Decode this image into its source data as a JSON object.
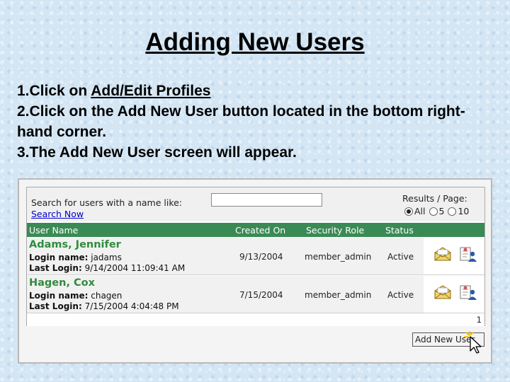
{
  "slide": {
    "title": "Adding New Users",
    "step1_prefix": "1.Click on ",
    "step1_link": "Add/Edit Profiles",
    "step2": "2.Click on the Add New User button located in the bottom right-hand corner.",
    "step3": "3.The Add New User screen will appear."
  },
  "search": {
    "label": "Search for users with a name like:",
    "value": "",
    "button": "Search Now"
  },
  "results_per_page": {
    "label": "Results / Page:",
    "options": [
      "All",
      "5",
      "10"
    ],
    "selected": "All"
  },
  "table": {
    "headers": {
      "user_name": "User Name",
      "created_on": "Created On",
      "security_role": "Security Role",
      "status": "Status"
    },
    "rows": [
      {
        "name": "Adams, Jennifer",
        "login_label": "Login name:",
        "login_value": "jadams",
        "last_login_label": "Last Login:",
        "last_login_value": "9/14/2004 11:09:41 AM",
        "created_on": "9/13/2004",
        "security_role": "member_admin",
        "status": "Active"
      },
      {
        "name": "Hagen, Cox",
        "login_label": "Login name:",
        "login_value": "chagen",
        "last_login_label": "Last Login:",
        "last_login_value": "7/15/2004 4:04:48 PM",
        "created_on": "7/15/2004",
        "security_role": "member_admin",
        "status": "Active"
      }
    ]
  },
  "pager": {
    "page": "1"
  },
  "add_button": {
    "label": "Add New User"
  },
  "colors": {
    "header_green": "#3a8a55",
    "name_green": "#2f8c3e",
    "link_blue": "#0000cc",
    "background": "#d4e6f4"
  },
  "icons": {
    "mail": "envelope-icon",
    "edit": "edit-user-icon",
    "cursor": "mouse-pointer-icon"
  }
}
